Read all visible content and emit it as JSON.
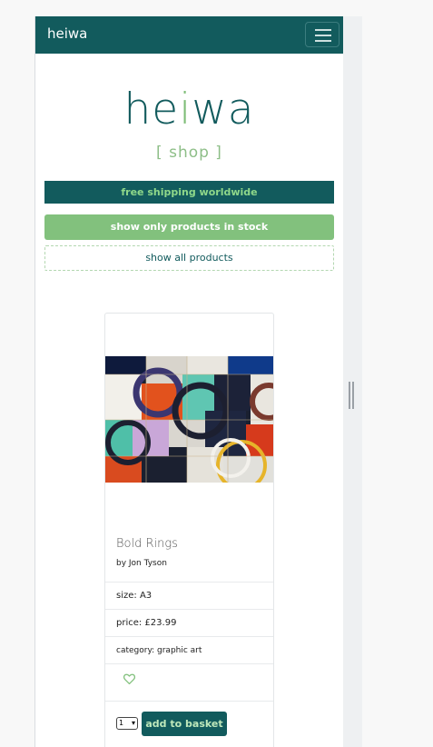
{
  "navbar": {
    "brand": "heiwa",
    "menu_icon": "hamburger-icon"
  },
  "hero": {
    "logo_prefix": "he",
    "logo_highlight": "i",
    "logo_suffix": "wa",
    "tagline": "[ shop ]"
  },
  "banners": {
    "shipping": "free shipping worldwide",
    "in_stock": "show only products in stock",
    "all": "show all products"
  },
  "product": {
    "image_icon": "abstract-rings-artwork",
    "title": "Bold Rings",
    "author": "by Jon Tyson",
    "size": "size: A3",
    "price": "price: £23.99",
    "category": "category: graphic art",
    "wishlist_icon": "heart-icon",
    "quantity": "1",
    "add_label": "add to basket"
  },
  "colors": {
    "primary": "#125b5d",
    "accent": "#82c17d",
    "accent_text": "#8fd88a"
  }
}
